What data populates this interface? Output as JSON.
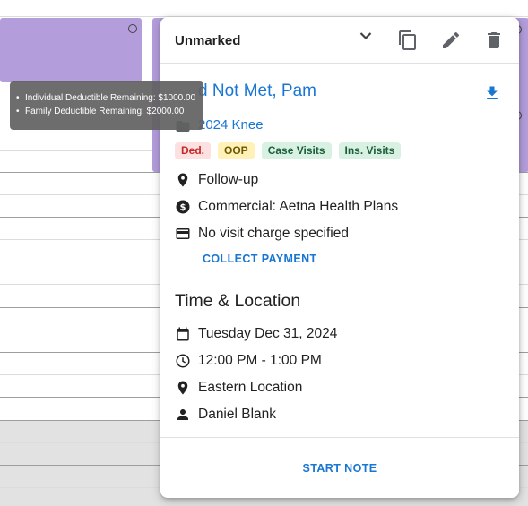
{
  "popover": {
    "status": {
      "label": "Unmarked"
    },
    "patient_name": "d Not Met, Pam",
    "case_name": "2024 Knee",
    "badges": [
      {
        "label": "Ded.",
        "bg": "#fde0e0",
        "color": "#c62828"
      },
      {
        "label": "OOP",
        "bg": "#fff1b8",
        "color": "#6d5800"
      },
      {
        "label": "Case Visits",
        "bg": "#d8f1e2",
        "color": "#1b5e3a"
      },
      {
        "label": "Ins. Visits",
        "bg": "#d8f1e2",
        "color": "#1b5e3a"
      }
    ],
    "visit_type": "Follow-up",
    "insurance": "Commercial: Aetna Health Plans",
    "visit_charge": "No visit charge specified",
    "collect_payment_label": "COLLECT PAYMENT",
    "time_location": {
      "title": "Time & Location",
      "date": "Tuesday Dec 31, 2024",
      "time": "12:00 PM - 1:00 PM",
      "location": "Eastern Location",
      "provider": "Daniel Blank"
    },
    "start_note_label": "START NOTE"
  },
  "tooltip": {
    "lines": [
      "Individual Deductible Remaining: $1000.00",
      "Family Deductible Remaining: $2000.00"
    ]
  },
  "icons": {
    "status_chevron": "chevron-down-icon",
    "copy": "copy-icon",
    "edit": "pencil-icon",
    "delete": "trash-icon",
    "download": "download-icon",
    "case": "folder-icon",
    "visit_type": "location-pin-icon",
    "insurance": "dollar-circle-icon",
    "visit_charge": "credit-card-icon",
    "date": "calendar-icon",
    "time": "clock-icon",
    "location": "location-pin-icon",
    "provider": "person-icon"
  },
  "colors": {
    "accent": "#1976d2",
    "appointment_block": "#b39ddb",
    "tooltip_bg": "#616161",
    "off_hours": "#e2e2e2"
  }
}
